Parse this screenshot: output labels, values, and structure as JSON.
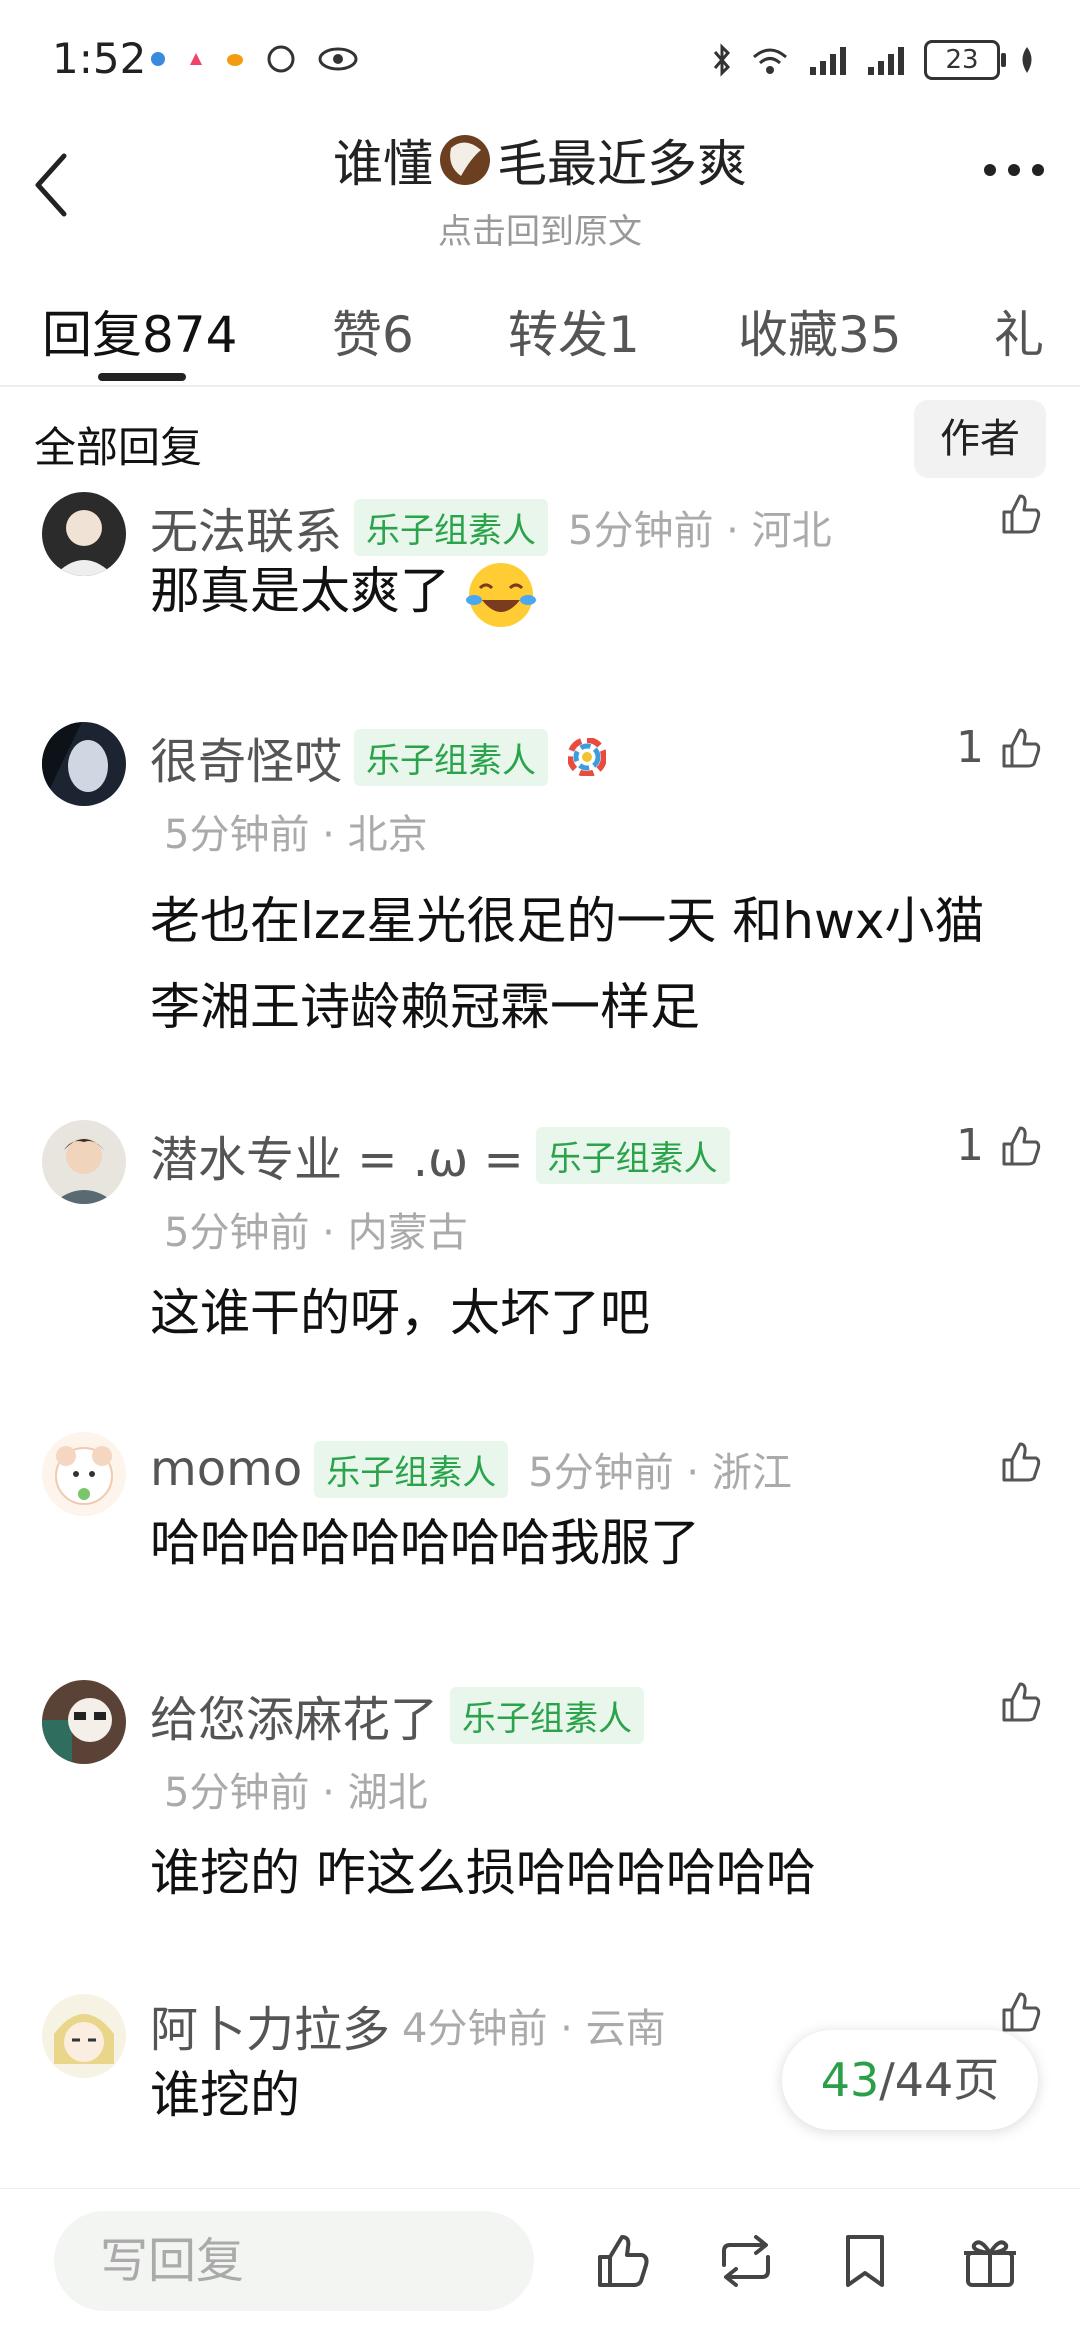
{
  "status_bar": {
    "time": "1:52",
    "battery": "23",
    "accent": "#2aa34a"
  },
  "header": {
    "title_before": "谁懂",
    "title_after": "毛最近多爽",
    "title_icon": "coconut-icon",
    "subtitle": "点击回到原文"
  },
  "tabs": [
    {
      "label": "回复874"
    },
    {
      "label": "赞6"
    },
    {
      "label": "转发1"
    },
    {
      "label": "收藏35"
    },
    {
      "label": "礼"
    }
  ],
  "filter": {
    "all_label": "全部回复",
    "author_label": "作者"
  },
  "comments": [
    {
      "name": "无法联系",
      "badge": "乐子组素人",
      "time_loc": "5分钟前 · 河北",
      "body": "那真是太爽了",
      "likes": ""
    },
    {
      "name": "很奇怪哎",
      "badge": "乐子组素人",
      "time_loc": "5分钟前 · 北京",
      "body": "老也在lzz星光很足的一天 和hwx小猫李湘王诗龄赖冠霖一样足",
      "likes": "1"
    },
    {
      "name": "潜水专业 = .ω =",
      "badge": "乐子组素人",
      "time_loc": "5分钟前 · 内蒙古",
      "body": "这谁干的呀，太坏了吧",
      "likes": "1"
    },
    {
      "name": "momo",
      "badge": "乐子组素人",
      "time_loc": "5分钟前 · 浙江",
      "body": "哈哈哈哈哈哈哈哈我服了",
      "likes": ""
    },
    {
      "name": "给您添麻花了",
      "badge": "乐子组素人",
      "time_loc": "5分钟前 · 湖北",
      "body": "谁挖的 咋这么损哈哈哈哈哈哈",
      "likes": ""
    },
    {
      "name": "阿卜力拉多",
      "badge": "",
      "time_loc": "4分钟前 · 云南",
      "body": "谁挖的",
      "likes": ""
    }
  ],
  "pager": {
    "current": "43",
    "total": "/44页"
  },
  "bottom_bar": {
    "reply_placeholder": "写回复"
  }
}
